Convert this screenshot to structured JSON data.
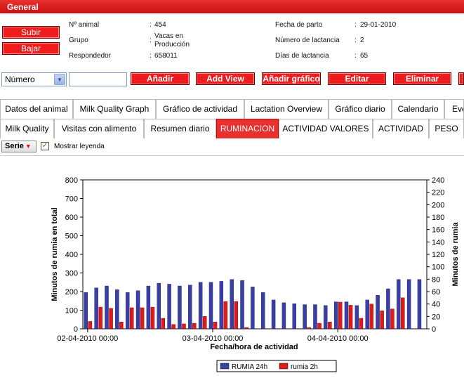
{
  "header": {
    "title": "General"
  },
  "buttons": {
    "up": "Subir",
    "down": "Bajar"
  },
  "info": {
    "animal_label": "Nº animal",
    "animal_value": "454",
    "group_label": "Grupo",
    "group_value_1": "Vacas en",
    "group_value_2": "Producción",
    "responder_label": "Respondedor",
    "responder_value": "658011",
    "birth_label": "Fecha de parto",
    "birth_value": "29-01-2010",
    "lact_num_label": "Número de lactancia",
    "lact_num_value": "2",
    "lact_days_label": "Días de lactancia",
    "lact_days_value": "65",
    "sep": ":"
  },
  "toolbar": {
    "select_value": "Número",
    "add": "Añadir",
    "add_view": "Add View",
    "add_chart": "Añadir gráfico",
    "edit": "Editar",
    "delete": "Eliminar"
  },
  "tabs_row1": [
    "Datos del animal",
    "Milk Quality Graph",
    "Gráfico de actividad",
    "Lactation Overview",
    "Gráfico diario",
    "Calendario",
    "Eve"
  ],
  "tabs_row2": [
    "Milk Quality",
    "Visitas con alimento",
    "Resumen diario",
    "RUMINACION",
    "ACTIVIDAD VALORES",
    "ACTIVIDAD",
    "PESO"
  ],
  "active_tab": "RUMINACION",
  "serie": {
    "label": "Serie",
    "show_legend": "Mostrar leyenda"
  },
  "colors": {
    "accent": "#e8302e",
    "series1": "#3a3ea8",
    "series2": "#e01a1a"
  },
  "chart_data": {
    "type": "bar",
    "xlabel": "Fecha/hora de actividad",
    "ylabel_left": "Minutos de rumia en total",
    "ylabel_right": "Minutos de rumia",
    "ylim_left": [
      0,
      800
    ],
    "ylim_right": [
      0,
      240
    ],
    "yticks_left": [
      "0",
      "100",
      "200",
      "300",
      "400",
      "500",
      "600",
      "700",
      "800"
    ],
    "yticks_right": [
      "0",
      "20",
      "40",
      "60",
      "80",
      "100",
      "120",
      "140",
      "160",
      "180",
      "200",
      "220",
      "240"
    ],
    "xticks": [
      {
        "index": 0,
        "label": "02-04-2010 00:00"
      },
      {
        "index": 12,
        "label": "03-04-2010 00:00"
      },
      {
        "index": 24,
        "label": "04-04-2010 00:00"
      }
    ],
    "series": [
      {
        "name": "RUMIA 24h",
        "axis": "left",
        "values": [
          195,
          220,
          230,
          210,
          195,
          205,
          230,
          245,
          240,
          230,
          235,
          250,
          250,
          255,
          265,
          260,
          225,
          195,
          155,
          140,
          135,
          130,
          130,
          125,
          145,
          145,
          125,
          155,
          180,
          215,
          265,
          265,
          265
        ]
      },
      {
        "name": "rumia 2h",
        "axis": "right",
        "values": [
          12,
          35,
          33,
          11,
          34,
          34,
          35,
          17,
          7,
          8,
          9,
          20,
          11,
          44,
          44,
          2,
          0,
          0,
          0,
          0,
          0,
          2,
          9,
          11,
          43,
          38,
          17,
          40,
          29,
          32,
          50,
          0,
          0
        ]
      }
    ],
    "legend_position": "bottom-center",
    "grid": false
  }
}
